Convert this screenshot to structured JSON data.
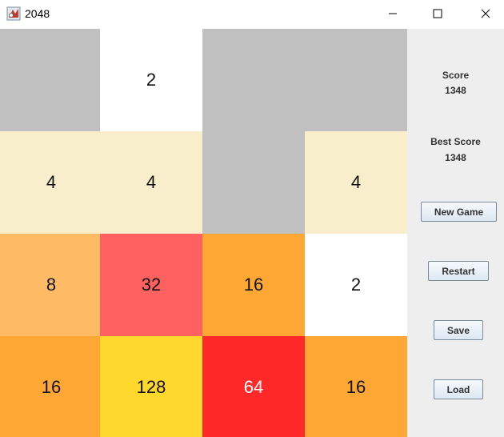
{
  "window": {
    "title": "2048",
    "icon": "java-app-icon",
    "controls": [
      "minimize-icon",
      "maximize-icon",
      "close-icon"
    ]
  },
  "board": {
    "rows": [
      [
        {
          "value": "",
          "color": "#c0c0c0"
        },
        {
          "value": "2",
          "color": "#ffffff"
        },
        {
          "value": "",
          "color": "#c0c0c0"
        },
        {
          "value": "",
          "color": "#c0c0c0"
        }
      ],
      [
        {
          "value": "4",
          "color": "#f8eecb"
        },
        {
          "value": "4",
          "color": "#f8eecb"
        },
        {
          "value": "",
          "color": "#c0c0c0"
        },
        {
          "value": "4",
          "color": "#f8eecb"
        }
      ],
      [
        {
          "value": "8",
          "color": "#ffba66"
        },
        {
          "value": "32",
          "color": "#ff6060"
        },
        {
          "value": "16",
          "color": "#ffa735"
        },
        {
          "value": "2",
          "color": "#ffffff"
        }
      ],
      [
        {
          "value": "16",
          "color": "#ffa735"
        },
        {
          "value": "128",
          "color": "#ffd82d"
        },
        {
          "value": "64",
          "color": "#ff2828"
        },
        {
          "value": "16",
          "color": "#ffa735"
        }
      ]
    ]
  },
  "sidebar": {
    "score_label": "Score",
    "score_value": "1348",
    "best_label": "Best Score",
    "best_value": "1348",
    "new_game": "New Game",
    "restart": "Restart",
    "save": "Save",
    "load": "Load"
  }
}
